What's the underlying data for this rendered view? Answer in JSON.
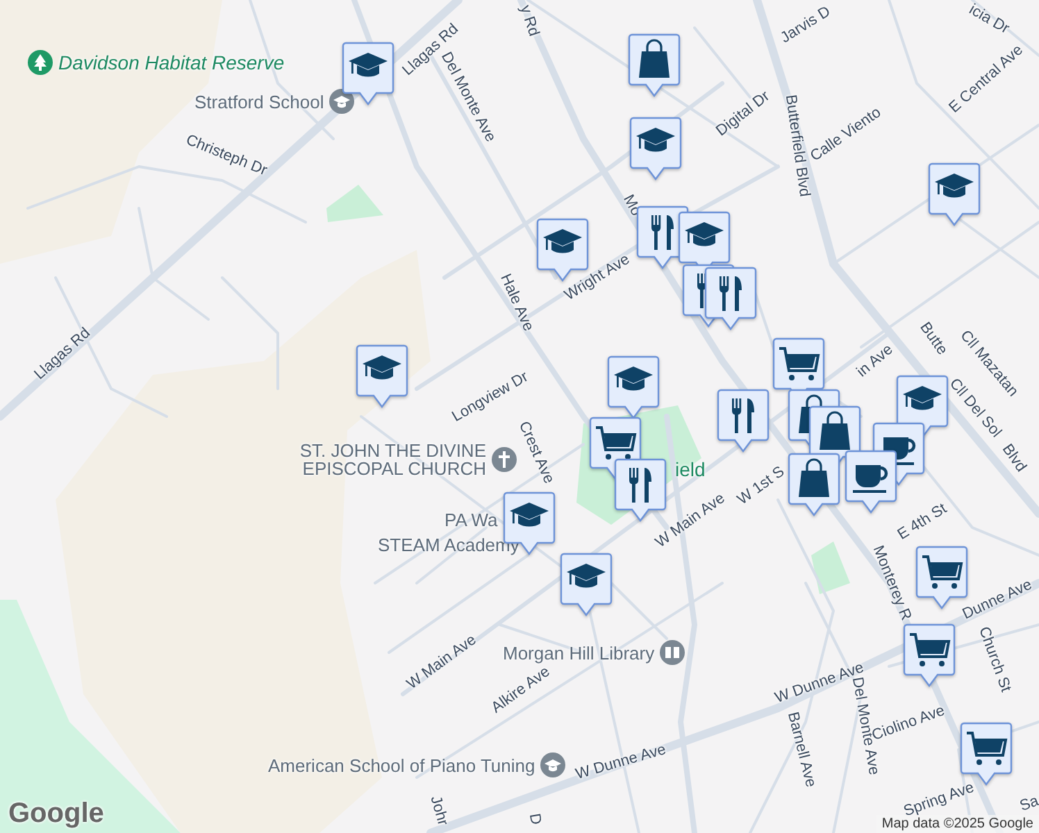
{
  "places": [
    {
      "text": "Davidson Habitat Reserve",
      "kind": "park"
    },
    {
      "text": "Stratford School",
      "kind": "school"
    },
    {
      "text": "ST. JOHN THE DIVINE EPISCOPAL CHURCH",
      "kind": "church"
    },
    {
      "text": "PA Wa",
      "kind": "plain"
    },
    {
      "text": "STEAM Academy",
      "kind": "plain"
    },
    {
      "text": "Morgan Hill Library",
      "kind": "library"
    },
    {
      "text": "American School of Piano Tuning",
      "kind": "school"
    },
    {
      "text": "ield",
      "kind": "parkplain"
    }
  ],
  "streets": [
    "Llagas Rd",
    "Llagas Rd",
    "Del Monte Ave",
    "Christeph Dr",
    "Hale Ave",
    "Longview Dr",
    "Crest Ave",
    "Wright Ave",
    "Jarvis D",
    "icia Dr",
    "Digital Dr",
    "Butterfield Blvd",
    "Calle Viento",
    "E Central Ave",
    "Cll Mazatan",
    "Cll Del Sol",
    "in Ave",
    "Butte",
    "y Rd",
    "Mo",
    "W Main Ave",
    "W Main Ave",
    "W 1st S",
    "E 4th St",
    "Monterey R",
    "Dunne Ave",
    "Church St",
    "W Dunne Ave",
    "W Dunne Ave",
    "Barnell Ave",
    "Del Monte Ave",
    "Ciolino Ave",
    "Spring Ave",
    "Sa",
    "Alkire Ave",
    "Johr",
    "D",
    "Blvd"
  ],
  "markers": [
    {
      "kind": "school"
    },
    {
      "kind": "bag"
    },
    {
      "kind": "school"
    },
    {
      "kind": "school"
    },
    {
      "kind": "restaurant"
    },
    {
      "kind": "school"
    },
    {
      "kind": "restaurant"
    },
    {
      "kind": "restaurant"
    },
    {
      "kind": "school"
    },
    {
      "kind": "school"
    },
    {
      "kind": "school"
    },
    {
      "kind": "cart"
    },
    {
      "kind": "school"
    },
    {
      "kind": "restaurant"
    },
    {
      "kind": "bag"
    },
    {
      "kind": "bag"
    },
    {
      "kind": "cart"
    },
    {
      "kind": "restaurant"
    },
    {
      "kind": "school"
    },
    {
      "kind": "school"
    },
    {
      "kind": "bag"
    },
    {
      "kind": "cafe"
    },
    {
      "kind": "cafe"
    },
    {
      "kind": "cart"
    },
    {
      "kind": "cart"
    },
    {
      "kind": "cart"
    }
  ],
  "attribution": {
    "logo": "Google",
    "text": "Map data ©2025 Google"
  }
}
